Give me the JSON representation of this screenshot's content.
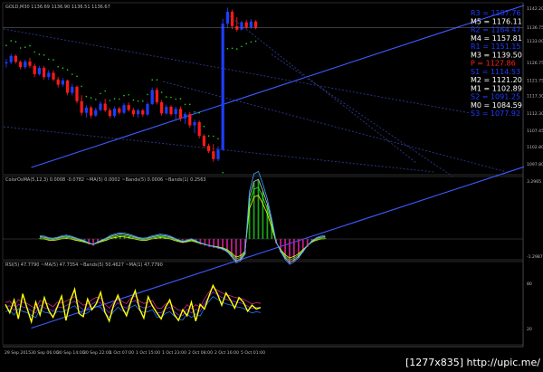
{
  "chart_data": {
    "type": "candlestick",
    "main_panel": {
      "header": "GOLD,M30  1136.69 1136.90 1136.51 1136.67",
      "price_labels": [
        "1142.20",
        "1136.75",
        "1133.00",
        "1126.75",
        "1121.75",
        "1117.30",
        "1112.30",
        "1107.45",
        "1102.80",
        "1097.80"
      ],
      "price_range": [
        1095,
        1143
      ],
      "candles": [
        [
          1126.5,
          1127.8,
          1125.3,
          1126.8
        ],
        [
          1126.8,
          1129.2,
          1126.2,
          1128.6
        ],
        [
          1128.6,
          1129.0,
          1126.4,
          1126.9
        ],
        [
          1126.9,
          1127.3,
          1124.8,
          1125.4
        ],
        [
          1125.4,
          1127.6,
          1124.9,
          1127.0
        ],
        [
          1127.0,
          1128.1,
          1125.2,
          1125.8
        ],
        [
          1125.8,
          1126.4,
          1122.6,
          1123.4
        ],
        [
          1123.4,
          1125.8,
          1123.0,
          1125.2
        ],
        [
          1125.2,
          1125.7,
          1121.9,
          1122.6
        ],
        [
          1122.6,
          1124.6,
          1121.8,
          1123.8
        ],
        [
          1123.8,
          1124.5,
          1121.4,
          1121.9
        ],
        [
          1121.9,
          1122.6,
          1119.6,
          1120.4
        ],
        [
          1120.4,
          1122.3,
          1119.8,
          1121.6
        ],
        [
          1121.6,
          1121.9,
          1117.4,
          1118.1
        ],
        [
          1118.1,
          1120.7,
          1117.3,
          1119.8
        ],
        [
          1119.8,
          1120.2,
          1115.1,
          1115.7
        ],
        [
          1115.7,
          1117.4,
          1111.6,
          1112.4
        ],
        [
          1112.4,
          1114.6,
          1111.0,
          1113.9
        ],
        [
          1113.9,
          1114.3,
          1110.8,
          1111.6
        ],
        [
          1111.6,
          1113.9,
          1111.2,
          1113.2
        ],
        [
          1113.2,
          1115.7,
          1112.8,
          1115.0
        ],
        [
          1115.0,
          1116.4,
          1112.6,
          1113.1
        ],
        [
          1113.1,
          1113.7,
          1110.9,
          1111.5
        ],
        [
          1111.5,
          1114.2,
          1111.0,
          1113.6
        ],
        [
          1113.6,
          1114.1,
          1111.9,
          1112.4
        ],
        [
          1112.4,
          1115.1,
          1112.0,
          1114.6
        ],
        [
          1114.6,
          1115.3,
          1112.7,
          1113.2
        ],
        [
          1113.2,
          1113.8,
          1111.2,
          1112.0
        ],
        [
          1112.0,
          1113.5,
          1110.9,
          1113.1
        ],
        [
          1113.1,
          1113.5,
          1111.3,
          1111.9
        ],
        [
          1111.9,
          1115.4,
          1111.5,
          1114.9
        ],
        [
          1114.9,
          1119.6,
          1114.6,
          1118.9
        ],
        [
          1118.9,
          1119.6,
          1114.8,
          1115.4
        ],
        [
          1115.4,
          1116.0,
          1111.6,
          1112.2
        ],
        [
          1112.2,
          1114.7,
          1111.8,
          1114.1
        ],
        [
          1114.1,
          1114.6,
          1111.4,
          1112.0
        ],
        [
          1112.0,
          1114.1,
          1110.5,
          1113.5
        ],
        [
          1113.5,
          1114.2,
          1110.0,
          1110.8
        ],
        [
          1110.8,
          1112.6,
          1109.2,
          1112.0
        ],
        [
          1112.0,
          1112.6,
          1108.1,
          1108.8
        ],
        [
          1108.8,
          1110.4,
          1106.6,
          1109.7
        ],
        [
          1109.7,
          1110.2,
          1105.1,
          1105.8
        ],
        [
          1105.8,
          1106.3,
          1102.4,
          1103.0
        ],
        [
          1103.0,
          1103.6,
          1100.9,
          1101.4
        ],
        [
          1101.4,
          1103.5,
          1098.4,
          1099.2
        ],
        [
          1099.2,
          1102.8,
          1098.6,
          1101.9
        ],
        [
          1101.9,
          1139.2,
          1101.5,
          1137.8
        ],
        [
          1137.8,
          1142.4,
          1136.5,
          1141.2
        ],
        [
          1141.2,
          1141.8,
          1136.2,
          1137.1
        ],
        [
          1137.1,
          1139.7,
          1135.6,
          1136.1
        ],
        [
          1136.1,
          1138.6,
          1135.9,
          1138.2
        ],
        [
          1138.2,
          1138.9,
          1136.3,
          1136.7
        ],
        [
          1136.7,
          1139.1,
          1136.4,
          1138.4
        ],
        [
          1138.4,
          1138.8,
          1136.2,
          1136.67
        ]
      ],
      "upper_channel": [
        [
          1105.3,
          1096.8
        ],
        [
          1210.0,
          1143.0
        ]
      ],
      "lower_channel": [
        [
          1105.3,
          1051.0
        ],
        [
          1210.0,
          1097.0
        ]
      ],
      "pivot_levels": [
        {
          "label": "R3",
          "value": "1187.76",
          "color": "#1f3cff"
        },
        {
          "label": "M5",
          "value": "1176.11",
          "color": "#ffffff"
        },
        {
          "label": "R2",
          "value": "1164.47",
          "color": "#1f3cff"
        },
        {
          "label": "M4",
          "value": "1157.81",
          "color": "#ffffff"
        },
        {
          "label": "R1",
          "value": "1151.15",
          "color": "#1f3cff"
        },
        {
          "label": "M3",
          "value": "1139.50",
          "color": "#ffffff"
        },
        {
          "label": "P",
          "value": "1127.86",
          "color": "#ff2020"
        },
        {
          "label": "S1",
          "value": "1114.53",
          "color": "#1f3cff"
        },
        {
          "label": "M2",
          "value": "1121.20",
          "color": "#ffffff"
        },
        {
          "label": "M1",
          "value": "1102.89",
          "color": "#ffffff"
        },
        {
          "label": "S2",
          "value": "1091.25",
          "color": "#1f3cff"
        },
        {
          "label": "M0",
          "value": "1084.59",
          "color": "#ffffff"
        },
        {
          "label": "S3",
          "value": "1077.92",
          "color": "#1f3cff"
        }
      ]
    },
    "macd_panel": {
      "header": "ColorOsMA(5,12,3) 0.0008 -0.0782  ~MA(5) 0.0002  ~Bands(5) 0.0006  ~Bands(1) 0.2563",
      "price_labels": [
        "3.2965",
        "-1.2987"
      ],
      "histogram": [
        0.02,
        0.01,
        -0.02,
        -0.03,
        -0.01,
        0.02,
        0.03,
        0.01,
        -0.02,
        -0.05,
        -0.08,
        -0.12,
        -0.15,
        -0.1,
        -0.06,
        -0.02,
        0.03,
        0.06,
        0.08,
        0.07,
        0.05,
        0.02,
        -0.01,
        -0.03,
        -0.02,
        0.01,
        0.03,
        0.05,
        0.04,
        0.02,
        -0.02,
        -0.06,
        -0.09,
        -0.07,
        -0.04,
        -0.08,
        -0.12,
        -0.15,
        -0.18,
        -0.2,
        -0.22,
        -0.25,
        -0.3,
        -0.4,
        -0.52,
        -0.48,
        -0.35,
        0.9,
        1.25,
        1.3,
        1.05,
        0.75,
        0.35,
        -0.1,
        -0.3,
        -0.45,
        -0.55,
        -0.5,
        -0.42,
        -0.3,
        -0.18,
        -0.08,
        -0.02,
        0.01,
        0.02
      ]
    },
    "rsi_panel": {
      "header": "RSI(5) 47.7790  ~MA(5) 47.7354  ~Bands(5) 50.4627  ~MA(1) 47.7790",
      "values": [
        52,
        41,
        58,
        33,
        66,
        47,
        29,
        55,
        38,
        61,
        44,
        35,
        49,
        63,
        31,
        57,
        72,
        40,
        36,
        59,
        45,
        53,
        68,
        42,
        30,
        51,
        64,
        48,
        37,
        56,
        70,
        46,
        34,
        62,
        50,
        41,
        33,
        48,
        58,
        39,
        31,
        45,
        37,
        55,
        30,
        52,
        46,
        62,
        77,
        66,
        51,
        67,
        58,
        47,
        61,
        55,
        43,
        51,
        46,
        48
      ],
      "range": [
        0,
        100
      ]
    },
    "time_labels": [
      "29 Sep 2015",
      "30 Sep 06:00",
      "30 Sep 14:00",
      "30 Sep 22:00",
      "1 Oct 07:00",
      "1 Oct 15:00",
      "1 Oct 23:00",
      "2 Oct 08:00",
      "2 Oct 16:00",
      "5 Oct 01:00"
    ],
    "axis_right": {
      "rsi_labels": [
        "80",
        "20"
      ]
    }
  },
  "watermark": "[1277x835] http://upic.me/"
}
